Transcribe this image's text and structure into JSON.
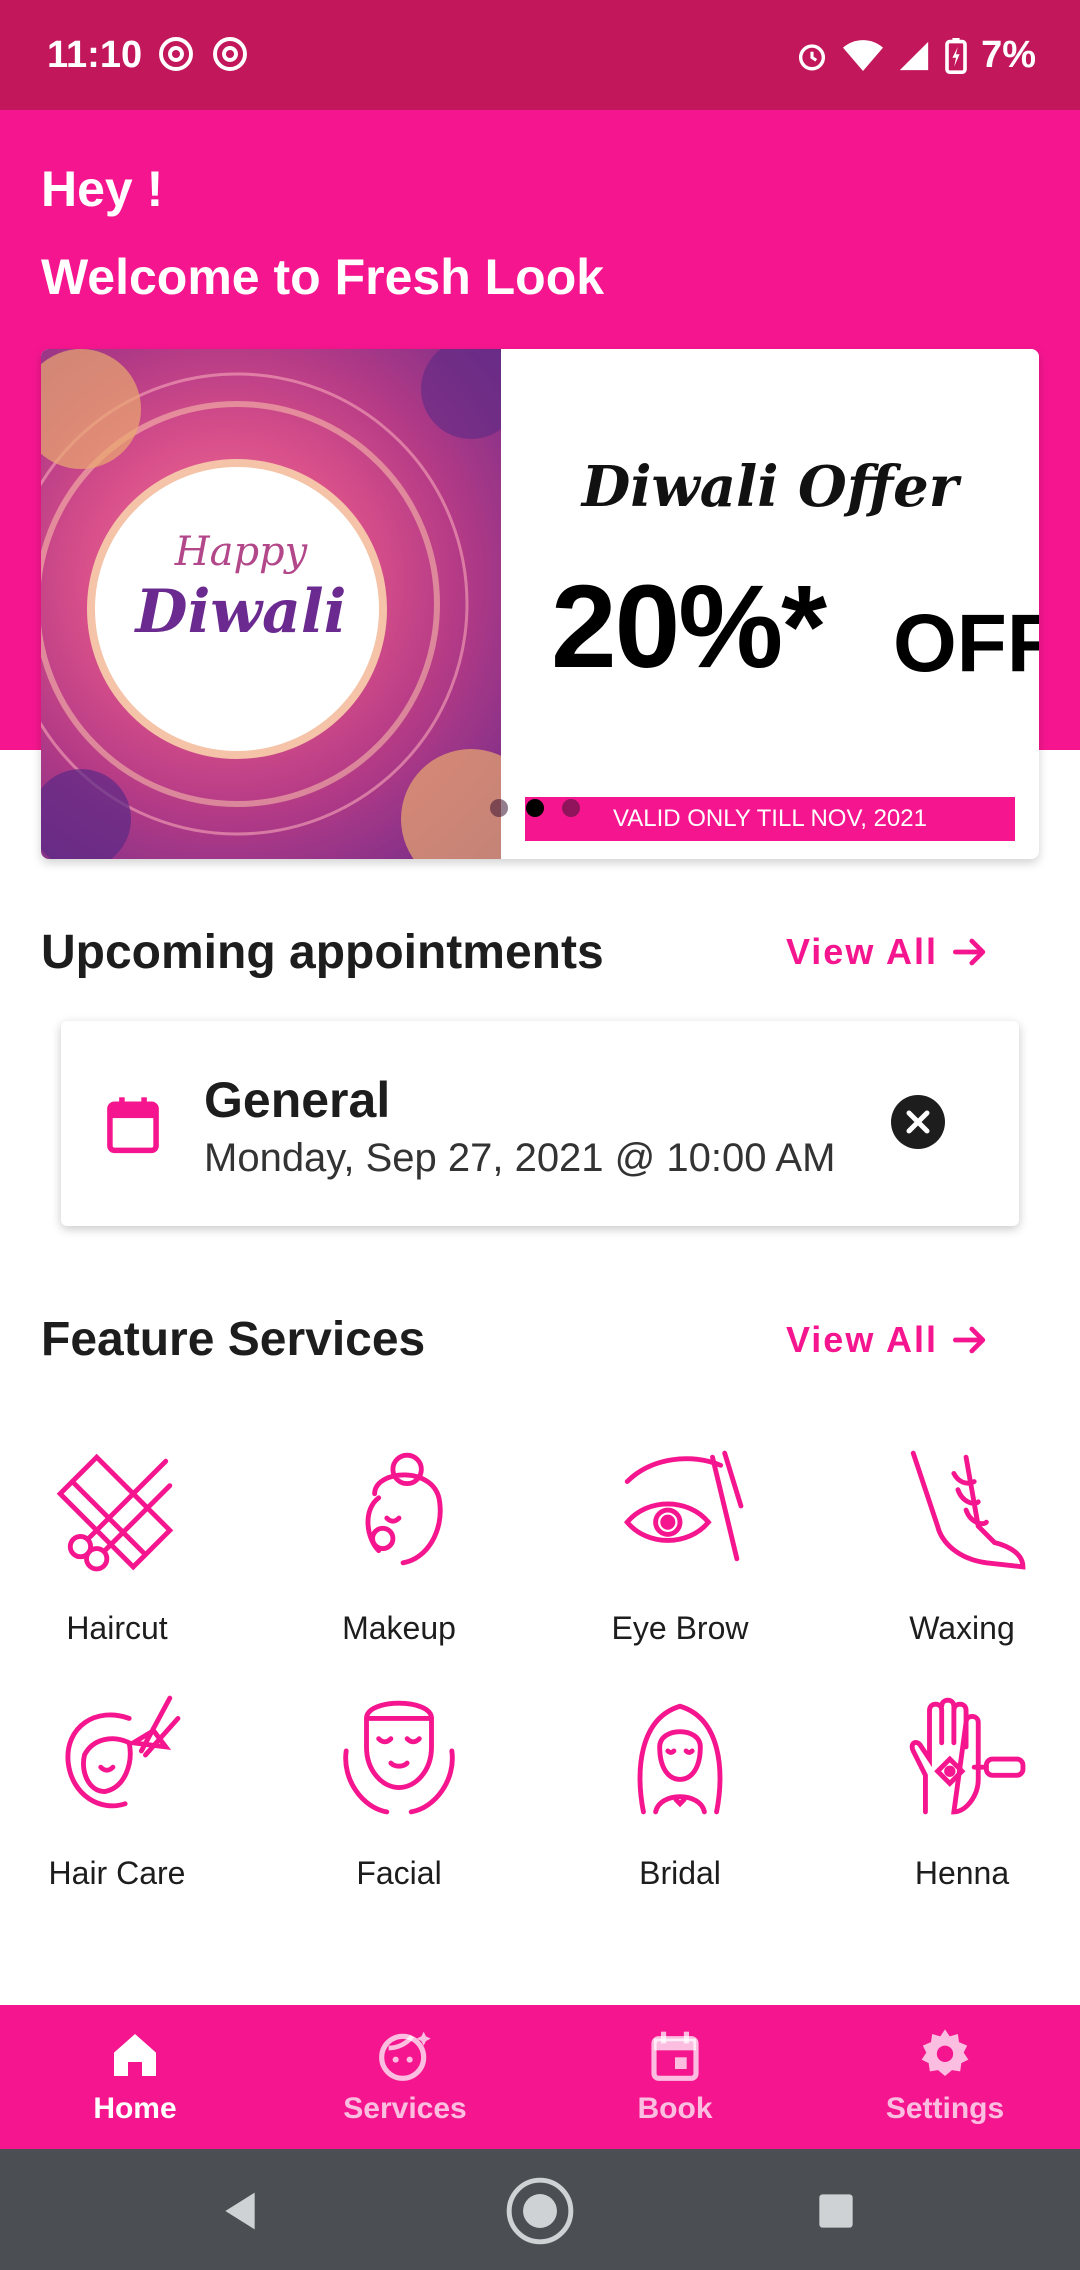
{
  "status_bar": {
    "time": "11:10",
    "battery": "7%"
  },
  "header": {
    "greeting": "Hey !",
    "welcome": "Welcome to Fresh Look"
  },
  "banner": {
    "left_happy": "Happy",
    "left_diwali": "Diwali",
    "offer_title": "Diwali Offer",
    "offer_percent": "20%*",
    "offer_off": "OFF",
    "valid_text": "VALID ONLY TILL NOV, 2021",
    "slides": 3,
    "active_slide": 2
  },
  "appointments": {
    "title": "Upcoming appointments",
    "view_all": "View All",
    "items": [
      {
        "title": "General",
        "date": "Monday, Sep 27, 2021 @ 10:00 AM"
      }
    ]
  },
  "services": {
    "title": "Feature Services",
    "view_all": "View All",
    "items": [
      {
        "label": "Haircut",
        "icon": "scissors-comb-icon"
      },
      {
        "label": "Makeup",
        "icon": "makeup-face-icon"
      },
      {
        "label": "Eye Brow",
        "icon": "eyebrow-icon"
      },
      {
        "label": "Waxing",
        "icon": "leg-waxing-icon"
      },
      {
        "label": "Hair Care",
        "icon": "hair-care-icon"
      },
      {
        "label": "Facial",
        "icon": "facial-icon"
      },
      {
        "label": "Bridal",
        "icon": "bridal-icon"
      },
      {
        "label": "Henna",
        "icon": "henna-hand-icon"
      }
    ]
  },
  "bottom_nav": {
    "items": [
      {
        "label": "Home",
        "icon": "home-icon",
        "active": true
      },
      {
        "label": "Services",
        "icon": "services-icon",
        "active": false
      },
      {
        "label": "Book",
        "icon": "calendar-icon",
        "active": false
      },
      {
        "label": "Settings",
        "icon": "gear-icon",
        "active": false
      }
    ]
  },
  "colors": {
    "primary": "#f5168f",
    "status_bar": "#c2185b",
    "system_nav": "#4b4f53"
  }
}
